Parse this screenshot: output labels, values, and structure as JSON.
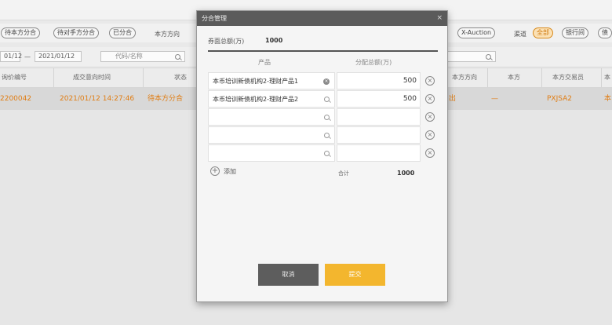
{
  "toolbar": {
    "pills_left": [
      "待本方分合",
      "待对手方分合",
      "已分合"
    ],
    "direction_label": "本方方向",
    "pill_xauction": "X-Auction",
    "channel_label": "渠道",
    "pills_right": [
      "全部",
      "银行间",
      "债"
    ]
  },
  "filter": {
    "date_from": "01/12",
    "date_to": "2021/01/12",
    "sep": "—",
    "code_placeholder": "代码/名称"
  },
  "table": {
    "headers": [
      "询价编号",
      "成交意向时间",
      "状态",
      "本方方向",
      "本方",
      "本方交易员",
      "本"
    ],
    "row": {
      "id": "2200042",
      "time": "2021/01/12 14:27:46",
      "status": "待本方分合",
      "direction": "出",
      "side": "—",
      "trader": "PXJSA2",
      "extra": "本"
    }
  },
  "modal": {
    "title": "分合管理",
    "close": "×",
    "total_label": "券面总额(万)",
    "total_value": "1000",
    "col_product": "产品",
    "col_amount": "分配总额(万)",
    "rows": [
      {
        "product": "本币培训新债机构2-理财产品1",
        "amount": "500"
      },
      {
        "product": "本币培训新债机构2-理财产品2",
        "amount": "500"
      },
      {
        "product": "",
        "amount": ""
      },
      {
        "product": "",
        "amount": ""
      },
      {
        "product": "",
        "amount": ""
      }
    ],
    "add_label": "添加",
    "sum_label": "合计",
    "sum_value": "1000",
    "cancel": "取消",
    "submit": "提交"
  },
  "colors": {
    "accent": "#f3b62e",
    "highlight_text": "#e07d14",
    "modal_header": "#5b5b5b"
  }
}
